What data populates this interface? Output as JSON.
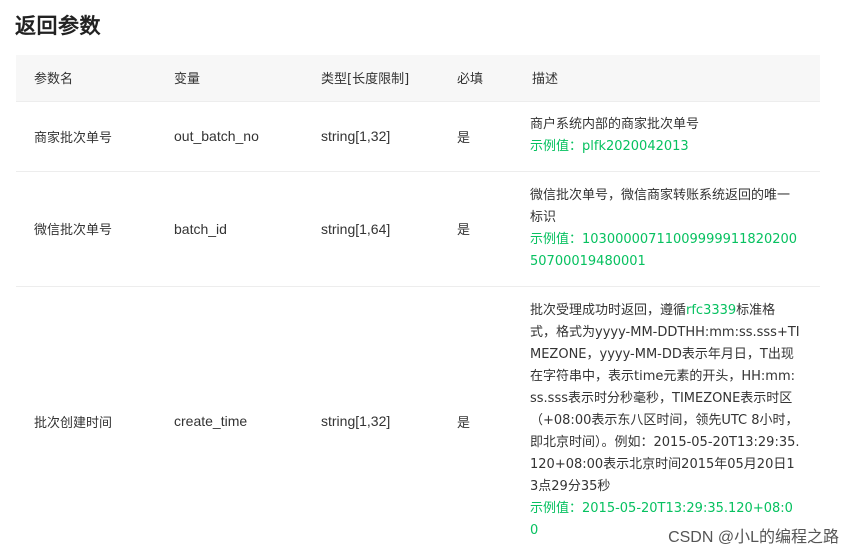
{
  "title": "返回参数",
  "headers": [
    "参数名",
    "变量",
    "类型[长度限制]",
    "必填",
    "描述"
  ],
  "rows": [
    {
      "name": "商家批次单号",
      "var": "out_batch_no",
      "type": "string[1,32]",
      "required": "是",
      "desc": "商户系统内部的商家批次单号",
      "example": "示例值：plfk2020042013"
    },
    {
      "name": "微信批次单号",
      "var": "batch_id",
      "type": "string[1,64]",
      "required": "是",
      "desc": "微信批次单号，微信商家转账系统返回的唯一标识",
      "example": "示例值：1030000071100999991182020050700019480001"
    },
    {
      "name": "批次创建时间",
      "var": "create_time",
      "type": "string[1,32]",
      "required": "是",
      "desc_pre": "批次受理成功时返回，遵循",
      "desc_link": "rfc3339",
      "desc_post": "标准格式，格式为yyyy-MM-DDTHH:mm:ss.sss+TIMEZONE，yyyy-MM-DD表示年月日，T出现在字符串中，表示time元素的开头，HH:mm:ss.sss表示时分秒毫秒，TIMEZONE表示时区（+08:00表示东八区时间，领先UTC 8小时，即北京时间）。例如：2015-05-20T13:29:35.120+08:00表示北京时间2015年05月20日13点29分35秒",
      "example": "示例值：2015-05-20T13:29:35.120+08:00"
    }
  ],
  "watermark": "CSDN @小L的编程之路"
}
